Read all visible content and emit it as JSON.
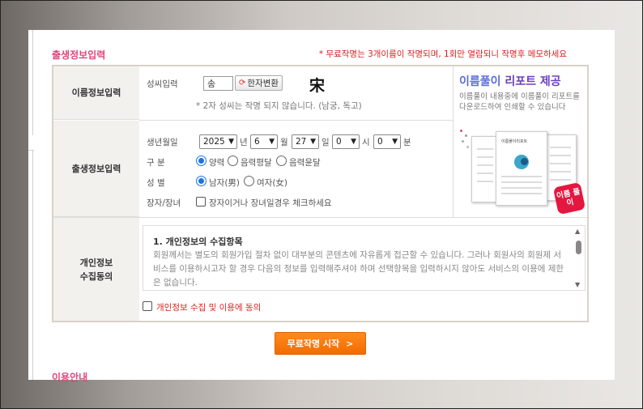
{
  "section": {
    "title": "출생정보입력",
    "notice": "* 무료작명는 3개이름이 작명되며, 1회만 열람되니 작명후 메모하세요"
  },
  "name_row": {
    "label": "이름정보입력",
    "surname_label": "성씨입력",
    "surname_value": "송",
    "hanja_button": "한자변환",
    "hanja_char": "宋",
    "hint": "* 2자 성씨는 작명 되지 않습니다. (남궁, 독고)"
  },
  "birth_row": {
    "label": "출생정보입력",
    "date_label": "생년월일",
    "year": "2025",
    "year_unit": "년",
    "month": "6",
    "month_unit": "월",
    "day": "27",
    "day_unit": "일",
    "hour": "0",
    "hour_unit": "시",
    "minute": "0",
    "minute_unit": "분",
    "calendar_label": "구 분",
    "calendar_options": [
      "양력",
      "음력평달",
      "음력윤달"
    ],
    "calendar_selected": "양력",
    "gender_label": "성 별",
    "gender_options": [
      "남자(男)",
      "여자(女)"
    ],
    "gender_selected": "남자(男)",
    "firstborn_label": "장자/장녀",
    "firstborn_check_label": "장자이거나 장녀일경우 체크하세요"
  },
  "report": {
    "title_a": "이름풀이",
    "title_b": "리포트 제공",
    "desc": "이름풀이 내용중에 이름풀이 리포트를 다운로드하여 인쇄할 수 있습니다",
    "doc_heading": "이름풀이리포트",
    "badge": "이름 풀이"
  },
  "privacy": {
    "label_line1": "개인정보",
    "label_line2": "수집동의",
    "heading": "1. 개인정보의 수집항목",
    "body": "회원께서는 별도의 회원가입 절차 없이 대부분의 콘텐츠에 자유롭게 접근할 수 있습니다. 그러나 회원사의 회원제 서비스를 이용하시고자 할 경우 다음의 정보를 입력해주셔야 하며 선택항목을 입력하시지 않아도 서비스의 이용에 제한은 없습니다.",
    "agree_label": "개인정보 수집 및 이용에 동의"
  },
  "start_button": "무료작명 시작",
  "usage_title": "이용안내",
  "colors": {
    "accent_pink": "#e0457b",
    "notice_red": "#e01e1e",
    "button_orange": "#f26c00",
    "report_blue": "#5b6edb",
    "badge_red": "#e3173f"
  }
}
